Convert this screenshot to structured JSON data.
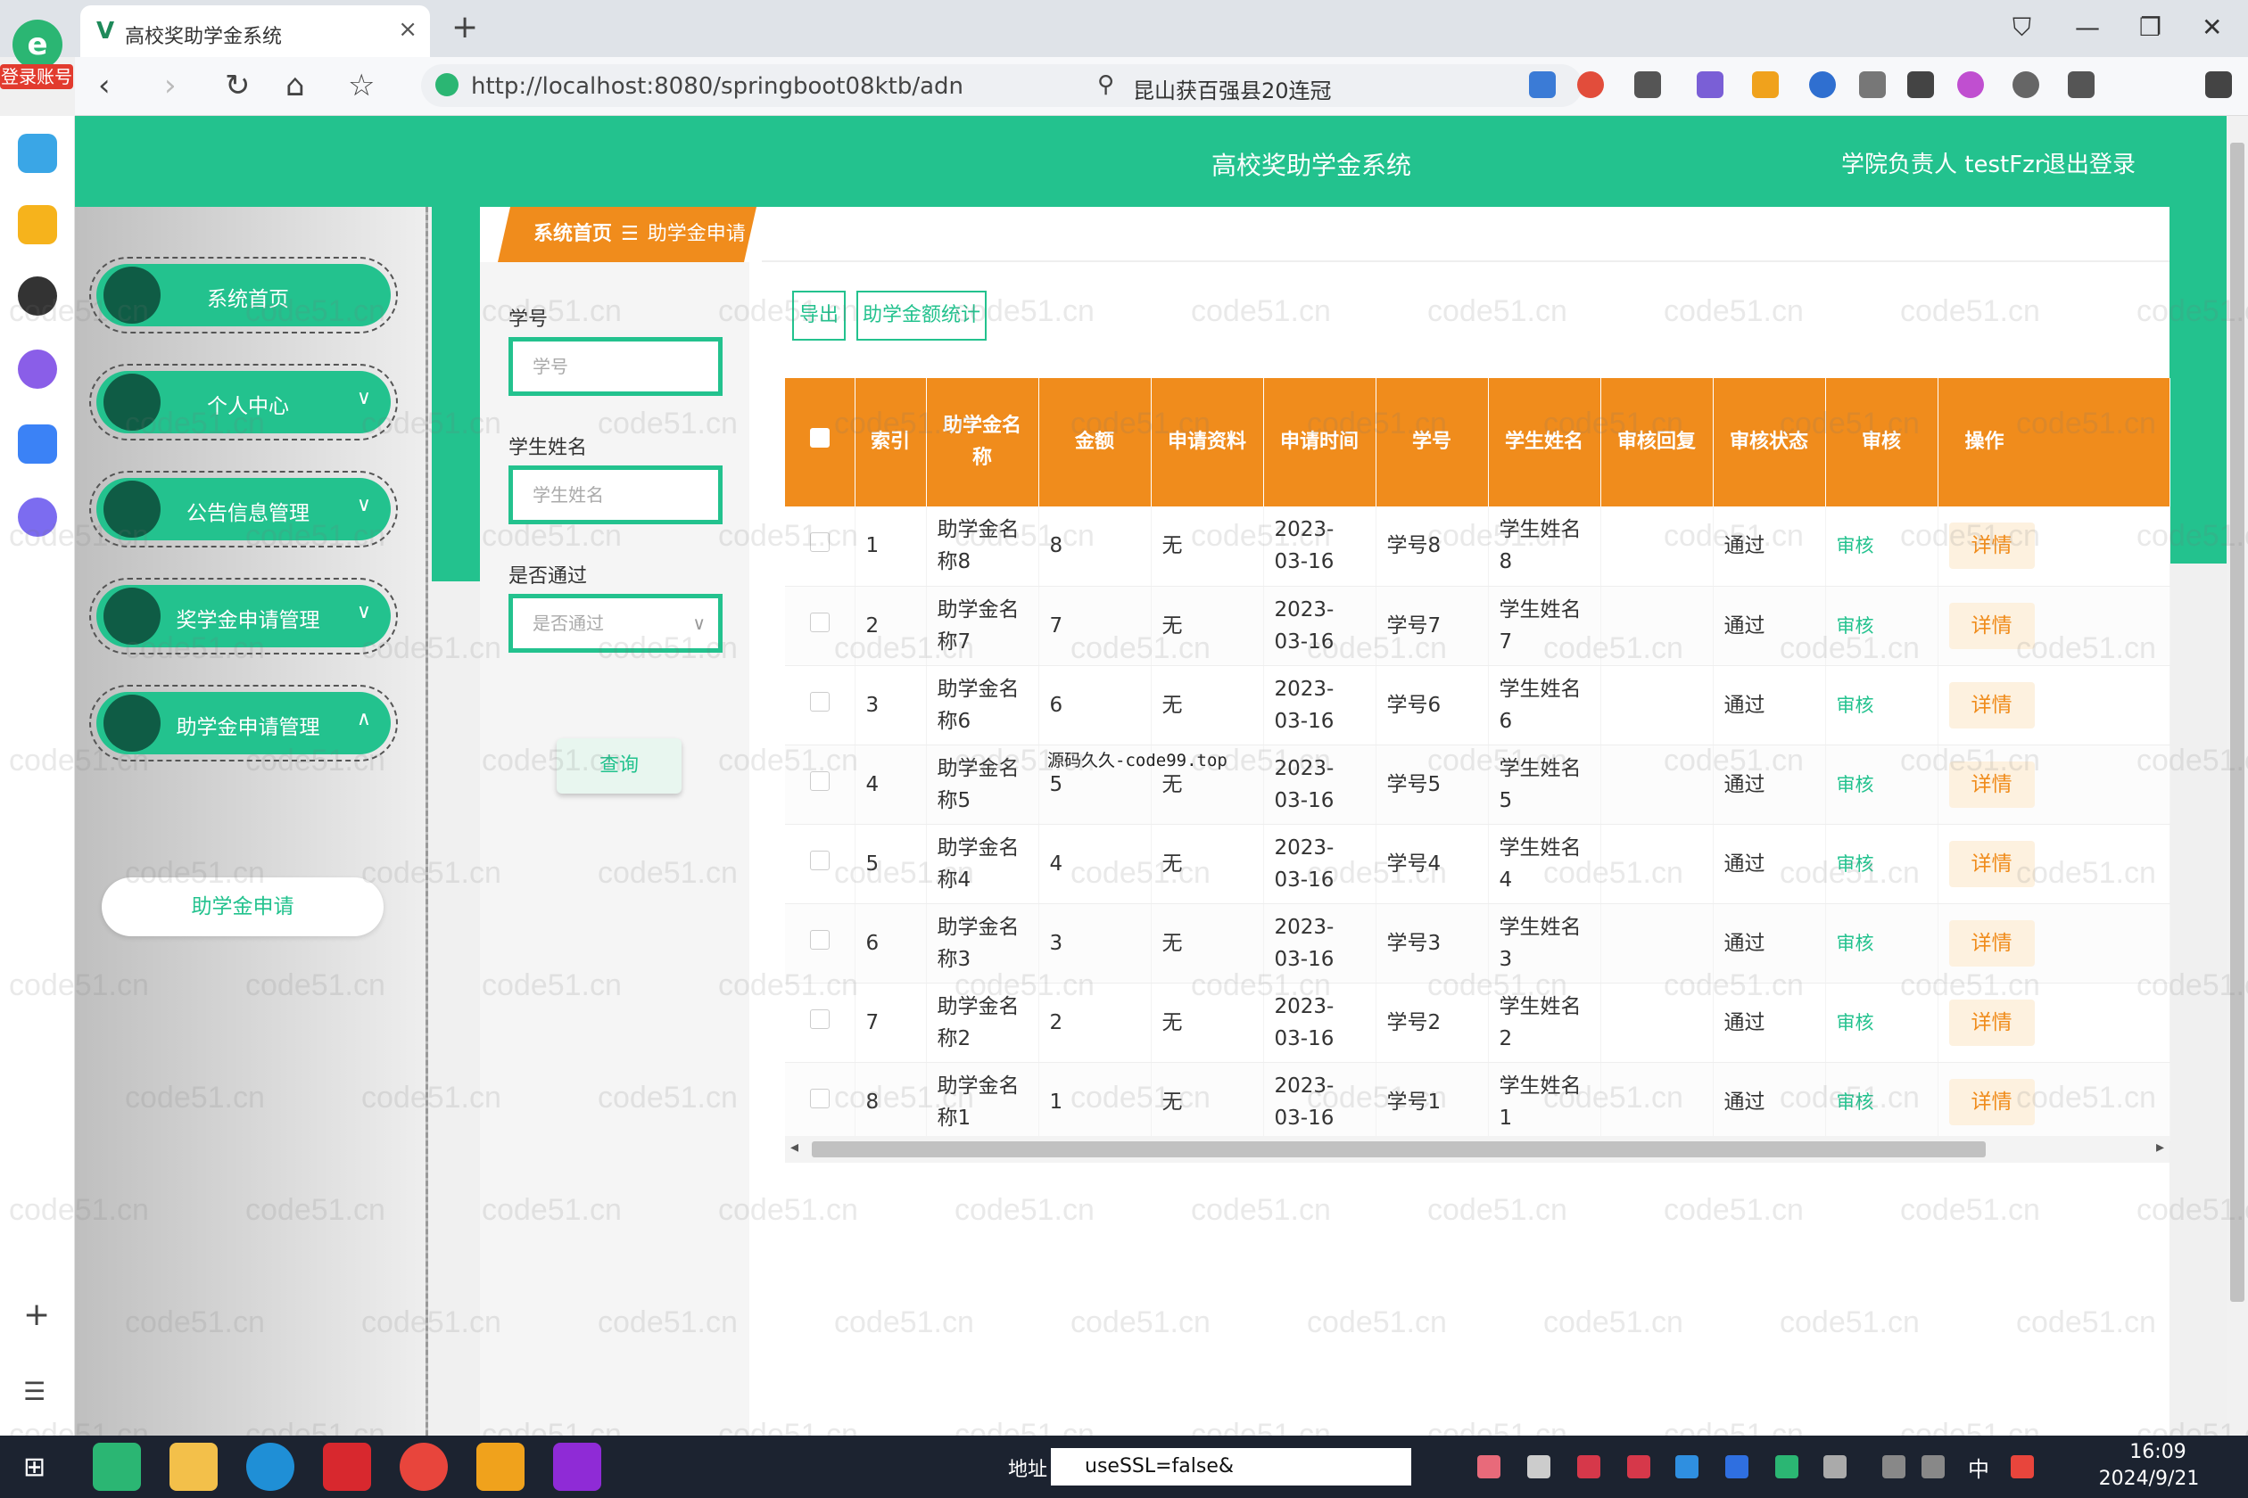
{
  "browser": {
    "login_badge": "登录账号",
    "tab_title": "高校奖助学金系统",
    "url": "http://localhost:8080/springboot08ktb/adn",
    "search_text": "昆山获百强县20连冠"
  },
  "app": {
    "title": "高校奖助学金系统",
    "user_info": "学院负责人 testFzr",
    "logout": "退出登录"
  },
  "breadcrumb": {
    "home": "系统首页",
    "separator": "☰",
    "current": "助学金申请"
  },
  "sidebar": {
    "items": [
      {
        "label": "系统首页",
        "expandable": false
      },
      {
        "label": "个人中心",
        "expandable": true
      },
      {
        "label": "公告信息管理",
        "expandable": true
      },
      {
        "label": "奖学金申请管理",
        "expandable": true
      },
      {
        "label": "助学金申请管理",
        "expandable": true,
        "expanded": true
      }
    ],
    "submenu": [
      "助学金申请"
    ]
  },
  "filters": {
    "student_id_label": "学号",
    "student_id_placeholder": "学号",
    "student_name_label": "学生姓名",
    "student_name_placeholder": "学生姓名",
    "passed_label": "是否通过",
    "passed_placeholder": "是否通过",
    "query_button": "查询"
  },
  "actions": {
    "export": "导出",
    "stats": "助学金额统计"
  },
  "table": {
    "headers": [
      "索引",
      "助学金名称",
      "金额",
      "申请资料",
      "申请时间",
      "学号",
      "学生姓名",
      "审核回复",
      "审核状态",
      "审核",
      "操作"
    ],
    "rows": [
      {
        "index": "1",
        "name": "助学金名称8",
        "amount": "8",
        "material": "无",
        "time": "2023-03-16",
        "student_id": "学号8",
        "student_name": "学生姓名8",
        "reply": "",
        "status": "通过",
        "review": "审核",
        "detail": "详情"
      },
      {
        "index": "2",
        "name": "助学金名称7",
        "amount": "7",
        "material": "无",
        "time": "2023-03-16",
        "student_id": "学号7",
        "student_name": "学生姓名7",
        "reply": "",
        "status": "通过",
        "review": "审核",
        "detail": "详情"
      },
      {
        "index": "3",
        "name": "助学金名称6",
        "amount": "6",
        "material": "无",
        "time": "2023-03-16",
        "student_id": "学号6",
        "student_name": "学生姓名6",
        "reply": "",
        "status": "通过",
        "review": "审核",
        "detail": "详情"
      },
      {
        "index": "4",
        "name": "助学金名称5",
        "amount": "5",
        "material": "无",
        "time": "2023-03-16",
        "student_id": "学号5",
        "student_name": "学生姓名5",
        "reply": "",
        "status": "通过",
        "review": "审核",
        "detail": "详情"
      },
      {
        "index": "5",
        "name": "助学金名称4",
        "amount": "4",
        "material": "无",
        "time": "2023-03-16",
        "student_id": "学号4",
        "student_name": "学生姓名4",
        "reply": "",
        "status": "通过",
        "review": "审核",
        "detail": "详情"
      },
      {
        "index": "6",
        "name": "助学金名称3",
        "amount": "3",
        "material": "无",
        "time": "2023-03-16",
        "student_id": "学号3",
        "student_name": "学生姓名3",
        "reply": "",
        "status": "通过",
        "review": "审核",
        "detail": "详情"
      },
      {
        "index": "7",
        "name": "助学金名称2",
        "amount": "2",
        "material": "无",
        "time": "2023-03-16",
        "student_id": "学号2",
        "student_name": "学生姓名2",
        "reply": "",
        "status": "通过",
        "review": "审核",
        "detail": "详情"
      },
      {
        "index": "8",
        "name": "助学金名称1",
        "amount": "1",
        "material": "无",
        "time": "2023-03-16",
        "student_id": "学号1",
        "student_name": "学生姓名1",
        "reply": "",
        "status": "通过",
        "review": "审核",
        "detail": "详情"
      }
    ]
  },
  "overlay_text": "源码久久-code99.top",
  "watermark_text": "code51.cn",
  "taskbar": {
    "address_label": "地址",
    "address_value": "useSSL=false&",
    "ime": "中",
    "time": "16:09",
    "date": "2024/9/21"
  },
  "colors": {
    "primary": "#23c28e",
    "accent": "#f08c1c",
    "sidebar_dot": "#0f5c45"
  },
  "icons": [
    "back-icon",
    "forward-icon",
    "reload-icon",
    "home-icon",
    "star-icon",
    "search-icon",
    "close-icon",
    "chevron-down-icon"
  ]
}
